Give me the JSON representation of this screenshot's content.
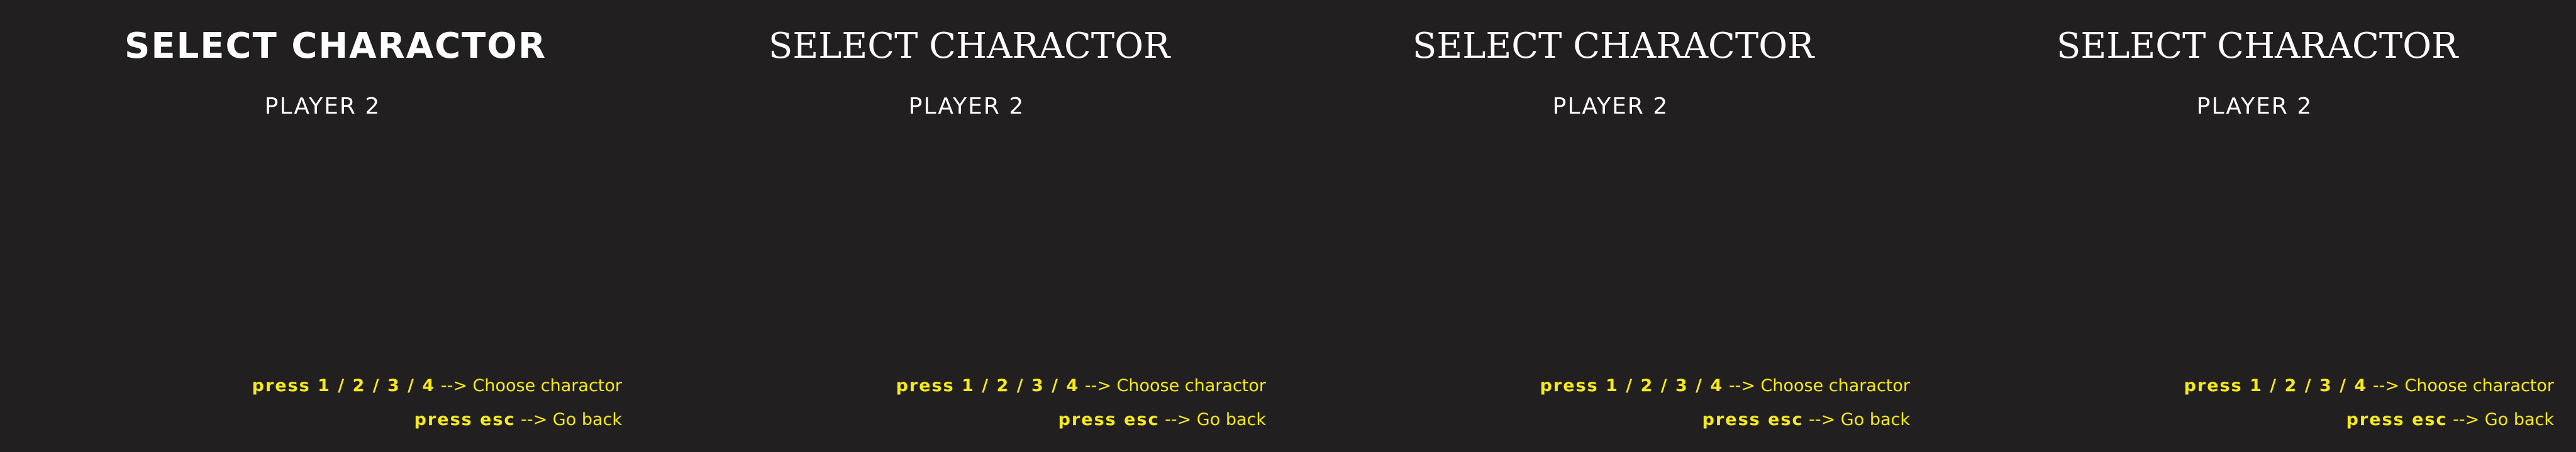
{
  "panels": [
    {
      "title": "SELECT CHARACTOR",
      "subtitle": "PLAYER 2",
      "hints": [
        {
          "key": "press 1 / 2 / 3 / 4",
          "arrow": "-->",
          "desc": "Choose charactor"
        },
        {
          "key": "press esc",
          "arrow": "-->",
          "desc": "Go back"
        }
      ]
    },
    {
      "title": "SELECT CHARACTOR",
      "subtitle": "PLAYER 2",
      "hints": [
        {
          "key": "press 1 / 2 / 3 / 4",
          "arrow": "-->",
          "desc": "Choose charactor"
        },
        {
          "key": "press esc",
          "arrow": "-->",
          "desc": "Go back"
        }
      ]
    },
    {
      "title": "SELECT CHARACTOR",
      "subtitle": "PLAYER 2",
      "hints": [
        {
          "key": "press 1 / 2 / 3 / 4",
          "arrow": "-->",
          "desc": "Choose charactor"
        },
        {
          "key": "press esc",
          "arrow": "-->",
          "desc": "Go back"
        }
      ]
    },
    {
      "title": "SELECT CHARACTOR",
      "subtitle": "PLAYER 2",
      "hints": [
        {
          "key": "press 1 / 2 / 3 / 4",
          "arrow": "-->",
          "desc": "Choose charactor"
        },
        {
          "key": "press esc",
          "arrow": "-->",
          "desc": "Go back"
        }
      ]
    }
  ],
  "colors": {
    "background": "#221f20",
    "title": "#ffffff",
    "hint": "#f5ea1c"
  }
}
